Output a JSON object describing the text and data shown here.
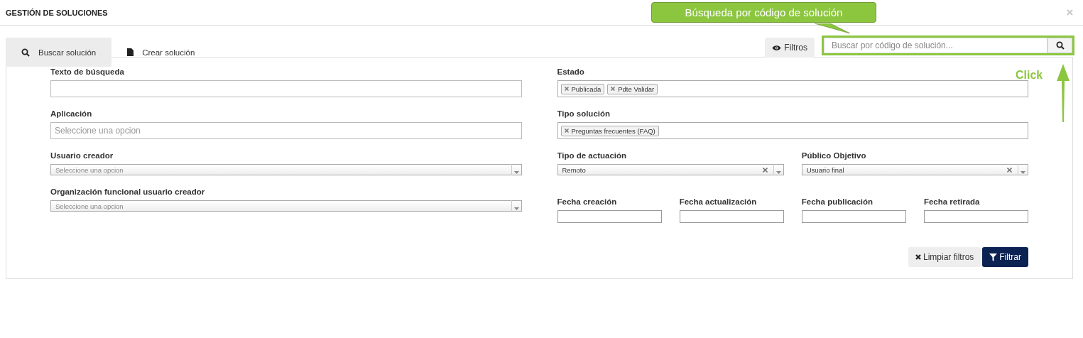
{
  "dialog": {
    "title": "GESTIÓN DE SOLUCIONES"
  },
  "tabs": [
    {
      "label": "Buscar solución",
      "kind": "search",
      "selected": true
    },
    {
      "label": "Crear solución",
      "kind": "create",
      "selected": false
    }
  ],
  "filters_button": "Filtros",
  "code_search": {
    "placeholder": "Buscar por código de solución..."
  },
  "left_fields": [
    {
      "kind": "input",
      "label": "Texto de búsqueda"
    },
    {
      "kind": "input",
      "label": "Aplicación",
      "placeholder": "Seleccione una opcion"
    },
    {
      "kind": "select",
      "label": "Usuario creador",
      "placeholder": "Seleccione una opcion"
    },
    {
      "kind": "select",
      "label": "Organización funcional usuario creador",
      "placeholder": "Seleccione una opcion"
    }
  ],
  "right_fields": [
    {
      "kind": "tags",
      "label": "Estado",
      "tags": [
        "Publicada",
        "Pdte Validar"
      ]
    },
    {
      "kind": "tags",
      "label": "Tipo solución",
      "tags": [
        "Preguntas frecuentes (FAQ)"
      ]
    },
    {
      "kind": "select",
      "label": "Tipo de actuación",
      "value": "Remoto"
    },
    {
      "kind": "select",
      "label": "Público Objetivo",
      "value": "Usuario final"
    },
    {
      "kind": "date",
      "label": "Fecha creación"
    },
    {
      "kind": "date",
      "label": "Fecha actualización"
    },
    {
      "kind": "date",
      "label": "Fecha publicación"
    },
    {
      "kind": "date",
      "label": "Fecha retirada"
    }
  ],
  "actions": {
    "clear": "Limpiar filtros",
    "filter": "Filtrar"
  },
  "annotation": {
    "callout": "Búsqueda por código de solución",
    "click": "Click"
  }
}
